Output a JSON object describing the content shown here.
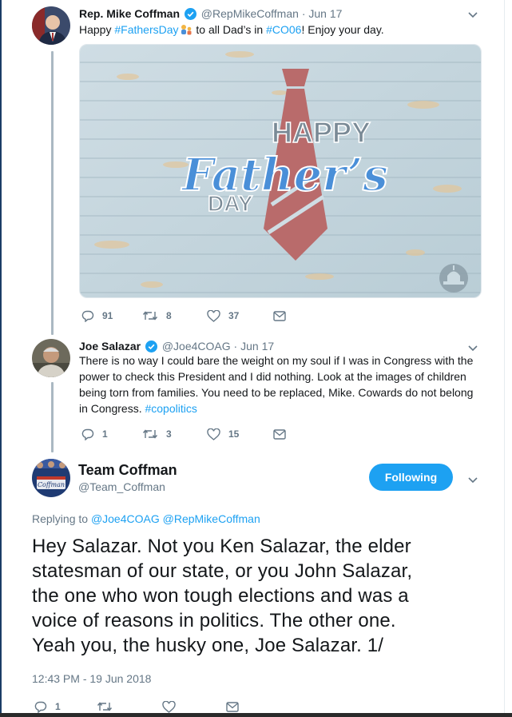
{
  "tweets": [
    {
      "name": "Rep. Mike Coffman",
      "handle": "@RepMikeCoffman",
      "separator": "·",
      "date": "Jun 17",
      "text_parts": [
        "Happy ",
        "#FathersDay",
        " to all Dad’s in ",
        "#CO06",
        "! Enjoy your day."
      ],
      "media_text": {
        "happy": "HAPPY",
        "fathers": "Father’s",
        "day": "DAY"
      },
      "counts": {
        "replies": "91",
        "retweets": "8",
        "likes": "37"
      }
    },
    {
      "name": "Joe Salazar",
      "handle": "@Joe4COAG",
      "separator": "·",
      "date": "Jun 17",
      "lines": [
        "There is no way I could bare the weight on my soul if I was in Congress with the",
        "power to check this President and I did nothing. Look at the images of children",
        "being torn from families. You need to be replaced, Mike. Cowards do not belong",
        "in Congress. "
      ],
      "hashtag": "#copolitics",
      "counts": {
        "replies": "1",
        "retweets": "3",
        "likes": "15"
      }
    }
  ],
  "main_tweet": {
    "name": "Team Coffman",
    "handle": "@Team_Coffman",
    "follow_label": "Following",
    "replying_label": "Replying to",
    "replying_to": "@Joe4COAG @RepMikeCoffman",
    "avatar_text": "Coffman",
    "lines": [
      "Hey Salazar. Not you Ken Salazar, the elder",
      "statesman of our state, or you John Salazar,",
      "the one who won tough elections and was a",
      "voice of reasons in politics. The other one.",
      "Yeah you, the husky one, Joe Salazar. 1/"
    ],
    "timestamp": "12:43 PM - 19 Jun 2018",
    "counts": {
      "replies": "1"
    }
  },
  "colors": {
    "accent": "#1da1f2",
    "muted": "#657786",
    "thread_line": "#aab8c2"
  },
  "icons": [
    "verified-icon",
    "chevron-down-icon",
    "reply-icon",
    "retweet-icon",
    "like-icon",
    "message-icon",
    "capitol-icon"
  ]
}
